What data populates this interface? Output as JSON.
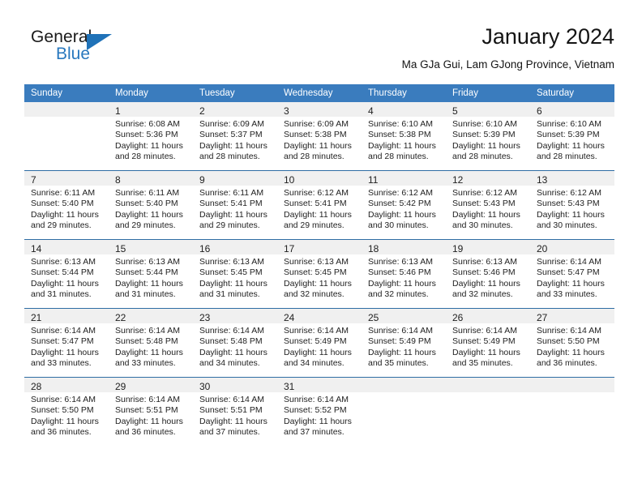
{
  "brand": {
    "word_general": "General",
    "word_blue": "Blue",
    "triangle_color": "#1f72b8",
    "blue_color": "#2878be"
  },
  "header": {
    "title": "January 2024",
    "subtitle": "Ma GJa Gui, Lam GJong Province, Vietnam"
  },
  "theme": {
    "header_bg": "#3a7cbe",
    "daynum_bg": "#f0f0f0",
    "row_divider": "#2e6da4",
    "text": "#222222"
  },
  "weekday_headers": [
    "Sunday",
    "Monday",
    "Tuesday",
    "Wednesday",
    "Thursday",
    "Friday",
    "Saturday"
  ],
  "weeks": [
    [
      {
        "day": "",
        "sunrise": "",
        "sunset": "",
        "daylight_line1": "",
        "daylight_line2": ""
      },
      {
        "day": "1",
        "sunrise": "Sunrise: 6:08 AM",
        "sunset": "Sunset: 5:36 PM",
        "daylight_line1": "Daylight: 11 hours",
        "daylight_line2": "and 28 minutes."
      },
      {
        "day": "2",
        "sunrise": "Sunrise: 6:09 AM",
        "sunset": "Sunset: 5:37 PM",
        "daylight_line1": "Daylight: 11 hours",
        "daylight_line2": "and 28 minutes."
      },
      {
        "day": "3",
        "sunrise": "Sunrise: 6:09 AM",
        "sunset": "Sunset: 5:38 PM",
        "daylight_line1": "Daylight: 11 hours",
        "daylight_line2": "and 28 minutes."
      },
      {
        "day": "4",
        "sunrise": "Sunrise: 6:10 AM",
        "sunset": "Sunset: 5:38 PM",
        "daylight_line1": "Daylight: 11 hours",
        "daylight_line2": "and 28 minutes."
      },
      {
        "day": "5",
        "sunrise": "Sunrise: 6:10 AM",
        "sunset": "Sunset: 5:39 PM",
        "daylight_line1": "Daylight: 11 hours",
        "daylight_line2": "and 28 minutes."
      },
      {
        "day": "6",
        "sunrise": "Sunrise: 6:10 AM",
        "sunset": "Sunset: 5:39 PM",
        "daylight_line1": "Daylight: 11 hours",
        "daylight_line2": "and 28 minutes."
      }
    ],
    [
      {
        "day": "7",
        "sunrise": "Sunrise: 6:11 AM",
        "sunset": "Sunset: 5:40 PM",
        "daylight_line1": "Daylight: 11 hours",
        "daylight_line2": "and 29 minutes."
      },
      {
        "day": "8",
        "sunrise": "Sunrise: 6:11 AM",
        "sunset": "Sunset: 5:40 PM",
        "daylight_line1": "Daylight: 11 hours",
        "daylight_line2": "and 29 minutes."
      },
      {
        "day": "9",
        "sunrise": "Sunrise: 6:11 AM",
        "sunset": "Sunset: 5:41 PM",
        "daylight_line1": "Daylight: 11 hours",
        "daylight_line2": "and 29 minutes."
      },
      {
        "day": "10",
        "sunrise": "Sunrise: 6:12 AM",
        "sunset": "Sunset: 5:41 PM",
        "daylight_line1": "Daylight: 11 hours",
        "daylight_line2": "and 29 minutes."
      },
      {
        "day": "11",
        "sunrise": "Sunrise: 6:12 AM",
        "sunset": "Sunset: 5:42 PM",
        "daylight_line1": "Daylight: 11 hours",
        "daylight_line2": "and 30 minutes."
      },
      {
        "day": "12",
        "sunrise": "Sunrise: 6:12 AM",
        "sunset": "Sunset: 5:43 PM",
        "daylight_line1": "Daylight: 11 hours",
        "daylight_line2": "and 30 minutes."
      },
      {
        "day": "13",
        "sunrise": "Sunrise: 6:12 AM",
        "sunset": "Sunset: 5:43 PM",
        "daylight_line1": "Daylight: 11 hours",
        "daylight_line2": "and 30 minutes."
      }
    ],
    [
      {
        "day": "14",
        "sunrise": "Sunrise: 6:13 AM",
        "sunset": "Sunset: 5:44 PM",
        "daylight_line1": "Daylight: 11 hours",
        "daylight_line2": "and 31 minutes."
      },
      {
        "day": "15",
        "sunrise": "Sunrise: 6:13 AM",
        "sunset": "Sunset: 5:44 PM",
        "daylight_line1": "Daylight: 11 hours",
        "daylight_line2": "and 31 minutes."
      },
      {
        "day": "16",
        "sunrise": "Sunrise: 6:13 AM",
        "sunset": "Sunset: 5:45 PM",
        "daylight_line1": "Daylight: 11 hours",
        "daylight_line2": "and 31 minutes."
      },
      {
        "day": "17",
        "sunrise": "Sunrise: 6:13 AM",
        "sunset": "Sunset: 5:45 PM",
        "daylight_line1": "Daylight: 11 hours",
        "daylight_line2": "and 32 minutes."
      },
      {
        "day": "18",
        "sunrise": "Sunrise: 6:13 AM",
        "sunset": "Sunset: 5:46 PM",
        "daylight_line1": "Daylight: 11 hours",
        "daylight_line2": "and 32 minutes."
      },
      {
        "day": "19",
        "sunrise": "Sunrise: 6:13 AM",
        "sunset": "Sunset: 5:46 PM",
        "daylight_line1": "Daylight: 11 hours",
        "daylight_line2": "and 32 minutes."
      },
      {
        "day": "20",
        "sunrise": "Sunrise: 6:14 AM",
        "sunset": "Sunset: 5:47 PM",
        "daylight_line1": "Daylight: 11 hours",
        "daylight_line2": "and 33 minutes."
      }
    ],
    [
      {
        "day": "21",
        "sunrise": "Sunrise: 6:14 AM",
        "sunset": "Sunset: 5:47 PM",
        "daylight_line1": "Daylight: 11 hours",
        "daylight_line2": "and 33 minutes."
      },
      {
        "day": "22",
        "sunrise": "Sunrise: 6:14 AM",
        "sunset": "Sunset: 5:48 PM",
        "daylight_line1": "Daylight: 11 hours",
        "daylight_line2": "and 33 minutes."
      },
      {
        "day": "23",
        "sunrise": "Sunrise: 6:14 AM",
        "sunset": "Sunset: 5:48 PM",
        "daylight_line1": "Daylight: 11 hours",
        "daylight_line2": "and 34 minutes."
      },
      {
        "day": "24",
        "sunrise": "Sunrise: 6:14 AM",
        "sunset": "Sunset: 5:49 PM",
        "daylight_line1": "Daylight: 11 hours",
        "daylight_line2": "and 34 minutes."
      },
      {
        "day": "25",
        "sunrise": "Sunrise: 6:14 AM",
        "sunset": "Sunset: 5:49 PM",
        "daylight_line1": "Daylight: 11 hours",
        "daylight_line2": "and 35 minutes."
      },
      {
        "day": "26",
        "sunrise": "Sunrise: 6:14 AM",
        "sunset": "Sunset: 5:49 PM",
        "daylight_line1": "Daylight: 11 hours",
        "daylight_line2": "and 35 minutes."
      },
      {
        "day": "27",
        "sunrise": "Sunrise: 6:14 AM",
        "sunset": "Sunset: 5:50 PM",
        "daylight_line1": "Daylight: 11 hours",
        "daylight_line2": "and 36 minutes."
      }
    ],
    [
      {
        "day": "28",
        "sunrise": "Sunrise: 6:14 AM",
        "sunset": "Sunset: 5:50 PM",
        "daylight_line1": "Daylight: 11 hours",
        "daylight_line2": "and 36 minutes."
      },
      {
        "day": "29",
        "sunrise": "Sunrise: 6:14 AM",
        "sunset": "Sunset: 5:51 PM",
        "daylight_line1": "Daylight: 11 hours",
        "daylight_line2": "and 36 minutes."
      },
      {
        "day": "30",
        "sunrise": "Sunrise: 6:14 AM",
        "sunset": "Sunset: 5:51 PM",
        "daylight_line1": "Daylight: 11 hours",
        "daylight_line2": "and 37 minutes."
      },
      {
        "day": "31",
        "sunrise": "Sunrise: 6:14 AM",
        "sunset": "Sunset: 5:52 PM",
        "daylight_line1": "Daylight: 11 hours",
        "daylight_line2": "and 37 minutes."
      },
      {
        "day": "",
        "sunrise": "",
        "sunset": "",
        "daylight_line1": "",
        "daylight_line2": ""
      },
      {
        "day": "",
        "sunrise": "",
        "sunset": "",
        "daylight_line1": "",
        "daylight_line2": ""
      },
      {
        "day": "",
        "sunrise": "",
        "sunset": "",
        "daylight_line1": "",
        "daylight_line2": ""
      }
    ]
  ]
}
